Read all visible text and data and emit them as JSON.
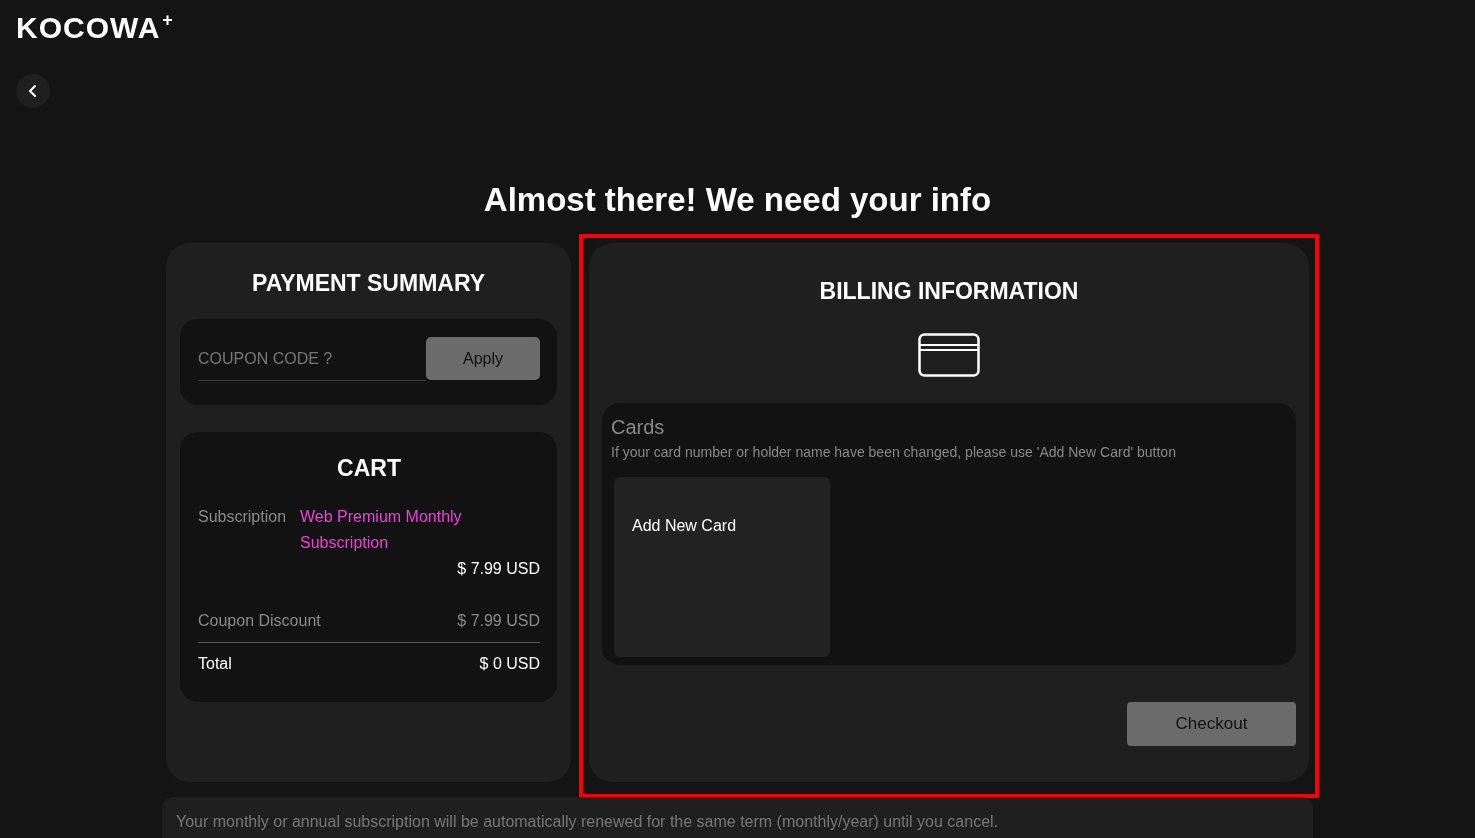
{
  "logo": {
    "name": "KOCOWA",
    "mark": "+"
  },
  "title": "Almost there! We need your info",
  "payment_summary": {
    "heading": "PAYMENT SUMMARY",
    "coupon": {
      "placeholder": "COUPON CODE ?",
      "button": "Apply"
    },
    "cart": {
      "heading": "CART",
      "subscription_label": "Subscription",
      "subscription_name": "Web Premium Monthly Subscription",
      "subscription_price": "$ 7.99 USD",
      "discount_label": "Coupon Discount",
      "discount_value": "$ 7.99 USD",
      "total_label": "Total",
      "total_value": "$ 0 USD"
    }
  },
  "billing": {
    "heading": "BILLING INFORMATION",
    "cards_label": "Cards",
    "cards_hint": "If your card number or holder name have been changed, please use 'Add New Card' button",
    "add_card": "Add New Card",
    "checkout": "Checkout",
    "highlighted": true
  },
  "notice": "Your monthly or annual subscription will be automatically renewed for the same term (monthly/year) until you cancel."
}
